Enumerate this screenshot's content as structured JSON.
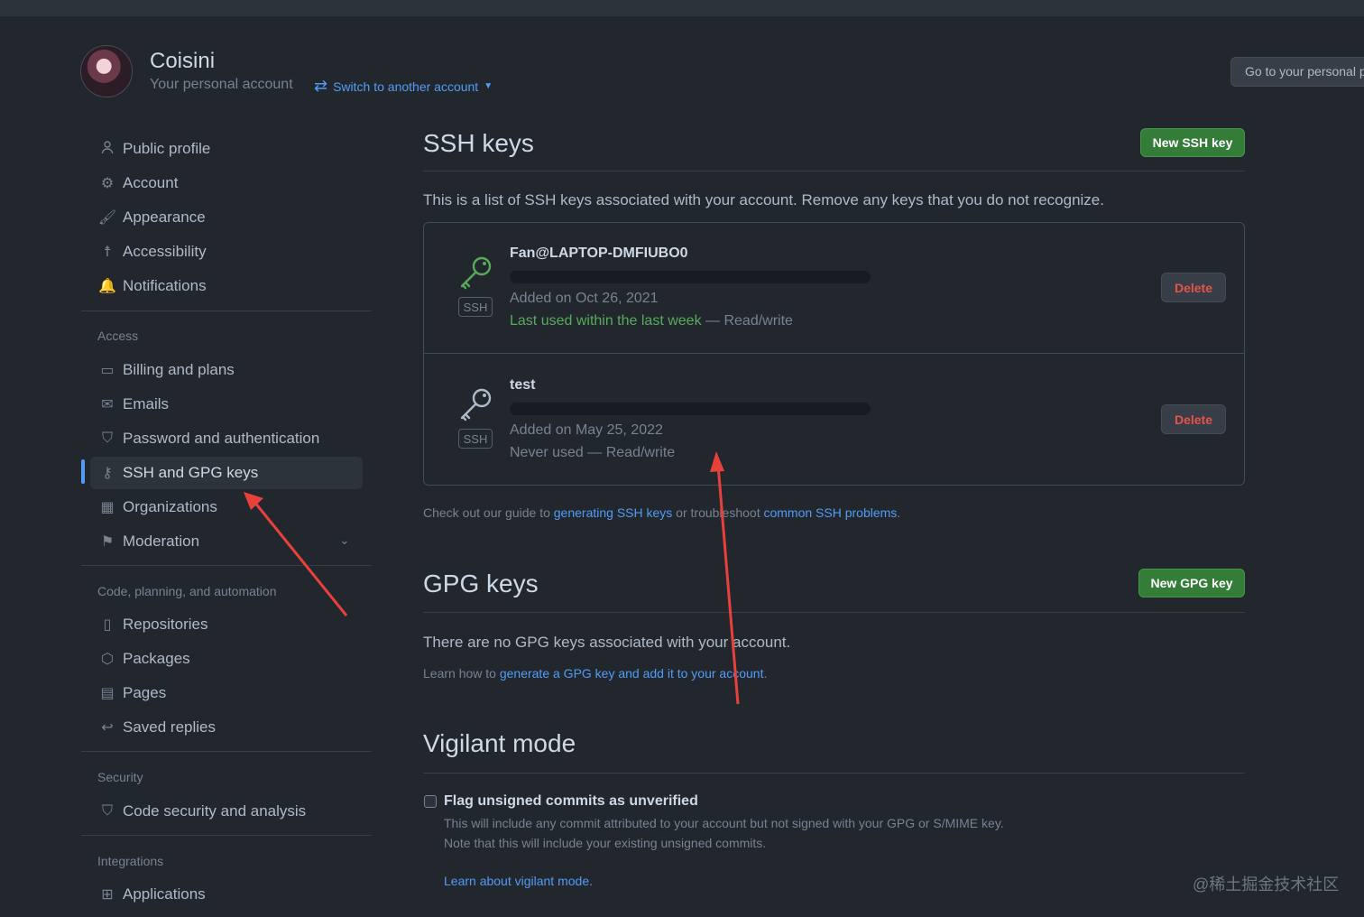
{
  "header": {
    "username": "Coisini",
    "subtitle": "Your personal account",
    "switch_label": "Switch to another account",
    "goto_label": "Go to your personal profile"
  },
  "sidebar": {
    "group1": [
      {
        "label": "Public profile",
        "icon": "person-icon"
      },
      {
        "label": "Account",
        "icon": "gear-icon"
      },
      {
        "label": "Appearance",
        "icon": "paintbrush-icon"
      },
      {
        "label": "Accessibility",
        "icon": "accessibility-icon"
      },
      {
        "label": "Notifications",
        "icon": "bell-icon"
      }
    ],
    "access_heading": "Access",
    "access": [
      {
        "label": "Billing and plans",
        "icon": "credit-card-icon"
      },
      {
        "label": "Emails",
        "icon": "mail-icon"
      },
      {
        "label": "Password and authentication",
        "icon": "shield-lock-icon"
      },
      {
        "label": "SSH and GPG keys",
        "icon": "key-icon"
      },
      {
        "label": "Organizations",
        "icon": "organization-icon"
      },
      {
        "label": "Moderation",
        "icon": "report-icon"
      }
    ],
    "code_heading": "Code, planning, and automation",
    "code": [
      {
        "label": "Repositories",
        "icon": "repo-icon"
      },
      {
        "label": "Packages",
        "icon": "package-icon"
      },
      {
        "label": "Pages",
        "icon": "browser-icon"
      },
      {
        "label": "Saved replies",
        "icon": "reply-icon"
      }
    ],
    "security_heading": "Security",
    "security": [
      {
        "label": "Code security and analysis",
        "icon": "shield-icon"
      }
    ],
    "integrations_heading": "Integrations",
    "integrations": [
      {
        "label": "Applications",
        "icon": "apps-icon"
      }
    ]
  },
  "ssh": {
    "title": "SSH keys",
    "new_button": "New SSH key",
    "description": "This is a list of SSH keys associated with your account. Remove any keys that you do not recognize.",
    "keys": [
      {
        "name": "Fan@LAPTOP-DMFIUBO0",
        "badge": "SSH",
        "added": "Added on Oct 26, 2021",
        "used": "Last used within the last week",
        "access": "— Read/write",
        "delete": "Delete",
        "status_color": "#57ab5a"
      },
      {
        "name": "test",
        "badge": "SSH",
        "added": "Added on May 25, 2022",
        "used": "Never used",
        "access": "— Read/write",
        "delete": "Delete",
        "status_color": "#768390"
      }
    ],
    "guide_prefix": "Check out our guide to ",
    "guide_link1": "generating SSH keys",
    "guide_mid": " or troubleshoot ",
    "guide_link2": "common SSH problems",
    "guide_suffix": "."
  },
  "gpg": {
    "title": "GPG keys",
    "new_button": "New GPG key",
    "empty": "There are no GPG keys associated with your account.",
    "learn_prefix": "Learn how to ",
    "learn_link": "generate a GPG key and add it to your account",
    "learn_suffix": "."
  },
  "vigilant": {
    "title": "Vigilant mode",
    "checkbox_label": "Flag unsigned commits as unverified",
    "help1": "This will include any commit attributed to your account but not signed with your GPG or S/MIME key.",
    "help2": "Note that this will include your existing unsigned commits.",
    "learn": "Learn about vigilant mode."
  },
  "watermark": "@稀土掘金技术社区",
  "colors": {
    "background": "#22272e",
    "accent": "#539bf5",
    "green_button": "#347d39",
    "danger": "#e5534b",
    "annotation_arrow": "#e8413c"
  }
}
